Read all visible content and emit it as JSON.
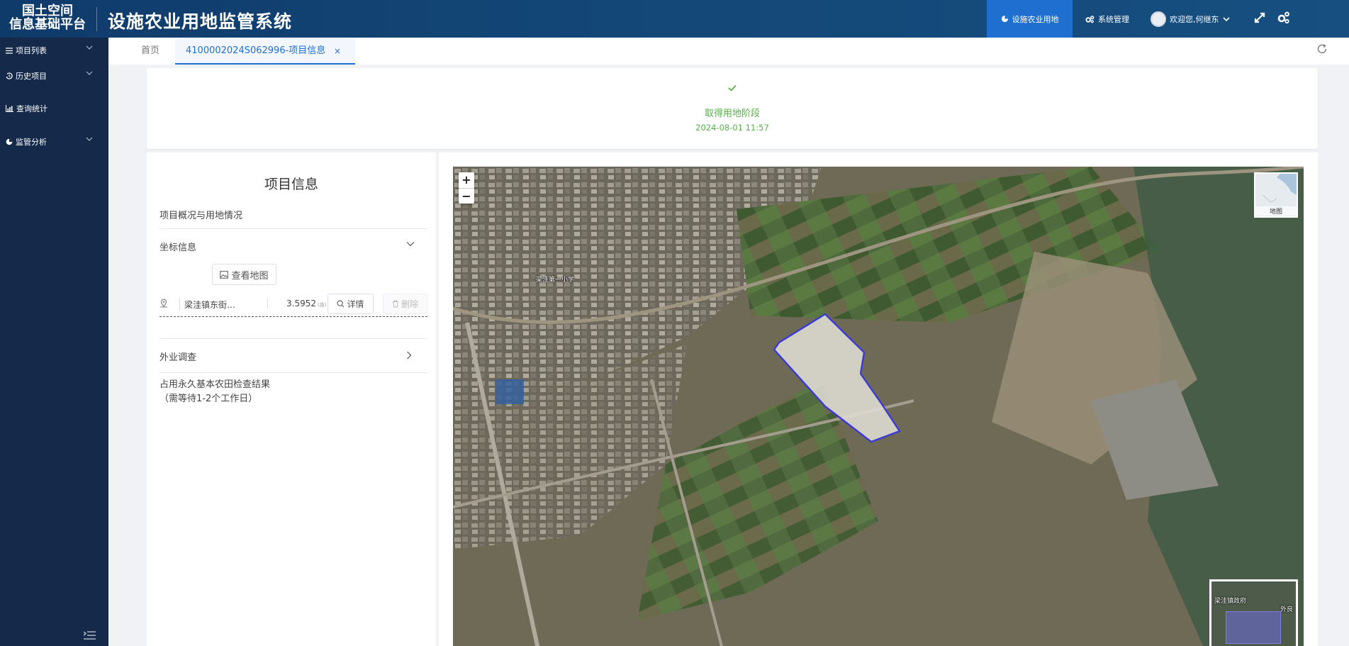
{
  "header": {
    "logo_line1": "国土空间",
    "logo_line2": "信息基础平台",
    "title": "设施农业用地监管系统",
    "nav_active": "设施农业用地",
    "nav_system": "系统管理",
    "user_greeting": "欢迎您,何继东"
  },
  "sidebar": {
    "items": [
      {
        "label": "项目列表"
      },
      {
        "label": "历史项目"
      },
      {
        "label": "查询统计"
      },
      {
        "label": "监管分析"
      }
    ]
  },
  "tabs": {
    "home": "首页",
    "active": "4100002024S062996-项目信息",
    "close": "×"
  },
  "stage": {
    "name": "取得用地阶段",
    "time": "2024-08-01 11:57"
  },
  "info": {
    "title": "项目信息",
    "subtitle": "项目概况与用地情况",
    "coord_label": "坐标信息",
    "view_map": "查看地图",
    "row": {
      "name": "梁洼镇东街…",
      "area": "3.5952",
      "unit": "(亩)",
      "detail": "详情",
      "delete": "删除"
    },
    "field_survey": "外业调查",
    "check_result_line1": "占用永久基本农田检查结果",
    "check_result_line2": "（需等待1-2个工作日）"
  },
  "map": {
    "zoom_in": "+",
    "zoom_out": "−",
    "layer_label": "地图",
    "label_school": "梁洼第一小学",
    "label_gov": "梁洼镇政府",
    "label_outside": "外良"
  },
  "colors": {
    "header_bg": "#134777",
    "sidebar_bg": "#152a4a",
    "accent": "#1f6fd1",
    "success": "#59b04a",
    "parcel_outline": "#3a3ad6"
  }
}
